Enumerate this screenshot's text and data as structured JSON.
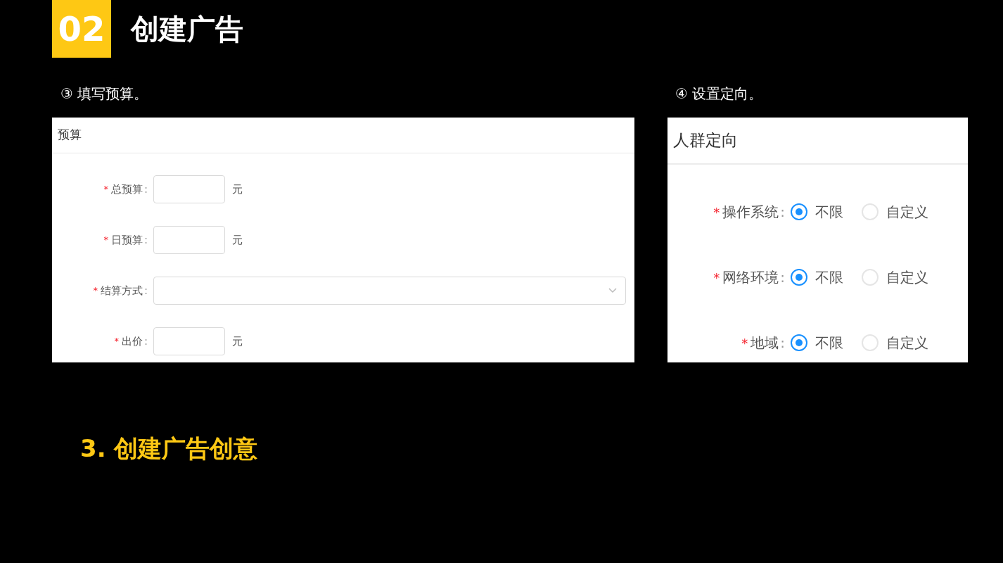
{
  "badge": "02",
  "title": "创建广告",
  "steps": [
    {
      "caption": "③ 填写预算。",
      "panel_title": "预算",
      "fields": [
        {
          "kind": "input",
          "mark": "*",
          "label": "总预算",
          "colon": ":",
          "unit": "元"
        },
        {
          "kind": "input",
          "mark": "*",
          "label": "日预算",
          "colon": ":",
          "unit": "元"
        },
        {
          "kind": "select",
          "mark": "*",
          "label": "结算方式",
          "colon": ":"
        },
        {
          "kind": "input",
          "mark": "*",
          "label": "出价",
          "colon": ":",
          "unit": "元"
        }
      ]
    },
    {
      "caption": "④ 设置定向。",
      "panel_title": "人群定向",
      "fields": [
        {
          "kind": "radio",
          "mark": "*",
          "label": "操作系统",
          "colon": ":",
          "options": [
            {
              "label": "不限",
              "selected": true
            },
            {
              "label": "自定义",
              "selected": false
            }
          ]
        },
        {
          "kind": "radio",
          "mark": "*",
          "label": "网络环境",
          "colon": ":",
          "options": [
            {
              "label": "不限",
              "selected": true
            },
            {
              "label": "自定义",
              "selected": false
            }
          ]
        },
        {
          "kind": "radio",
          "mark": "*",
          "label": "地域",
          "colon": ":",
          "options": [
            {
              "label": "不限",
              "selected": true
            },
            {
              "label": "自定义",
              "selected": false
            }
          ]
        }
      ]
    }
  ],
  "next_heading": "3. 创建广告创意"
}
